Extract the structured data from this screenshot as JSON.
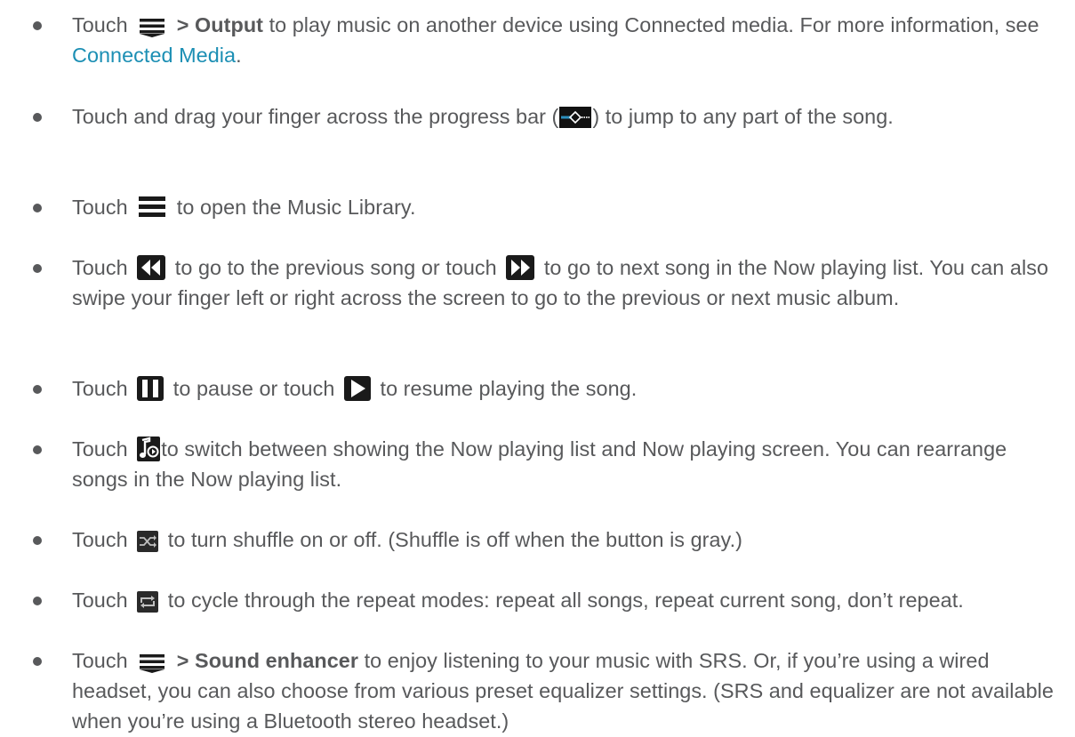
{
  "items": [
    {
      "touch": "Touch",
      "icon": "menu-icon",
      "bold": "> Output",
      "rest": "to play music on another device using Connected media. For more information, see",
      "link": "Connected Media",
      "end": "."
    },
    {
      "pre": "Touch and drag your finger across the progress bar (",
      "icon": "progress-bar-icon",
      "post": ") to jump to any part of the song."
    },
    {
      "touch": "Touch",
      "icon": "music-library-icon",
      "post": "to open the Music Library."
    },
    {
      "touch": "Touch",
      "icon1": "previous-icon",
      "mid": "to go to the previous song or touch",
      "icon2": "next-icon",
      "post": "to go to next song in the Now playing list. You can also swipe your finger left or right across the screen to go to the previous or next music album."
    },
    {
      "touch": "Touch",
      "icon1": "pause-icon",
      "mid": "to pause or touch",
      "icon2": "play-icon",
      "post": "to resume playing the song."
    },
    {
      "touch": "Touch",
      "icon": "now-playing-toggle-icon",
      "post": "to switch between showing the Now playing list and Now playing screen. You can rearrange songs in the Now playing list."
    },
    {
      "touch": "Touch",
      "icon": "shuffle-icon",
      "post": "to turn shuffle on or off. (Shuffle is off when the button is gray.)"
    },
    {
      "touch": "Touch",
      "icon": "repeat-icon",
      "post": "to cycle through the repeat modes: repeat all songs, repeat current song, don’t repeat."
    },
    {
      "touch": "Touch",
      "icon": "menu-icon",
      "bold": "> Sound enhancer",
      "post": "to enjoy listening to your music with SRS. Or, if you’re using a wired headset, you can also choose from various preset equalizer settings. (SRS and equalizer are not available when you’re using a Bluetooth stereo headset.)"
    }
  ],
  "colors": {
    "text": "#58595b",
    "link": "#1c8fb4"
  }
}
